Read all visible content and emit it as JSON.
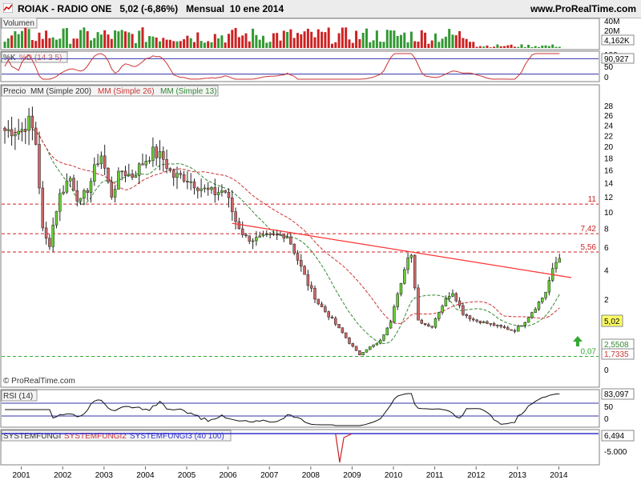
{
  "header": {
    "ticker": "ROIAK - RADIO ONE",
    "price_change": "5,02 (-6,86%)",
    "period": "Mensual",
    "date": "10 ene 2014",
    "site": "www.ProRealTime.com"
  },
  "volume_panel": {
    "label": "Volumen",
    "tick_top": "40M",
    "tick_mid": "20M",
    "last_value": "4,162K"
  },
  "stoch_panel": {
    "label_k": "%K",
    "label_d": "%D (14 3 5)",
    "tick_top": "100",
    "tick_mid": "50",
    "tick_bottom": "0",
    "last_value": "90,927"
  },
  "price_panel": {
    "label_price": "Precio",
    "label_mm200": "MM (Simple 200)",
    "label_mm26": "MM (Simple 26)",
    "label_mm13": "MM (Simple 13)",
    "copyright": "© ProRealTime.com",
    "hlines": [
      {
        "value": 11,
        "label": "11"
      },
      {
        "value": 7.42,
        "label": "7,42"
      },
      {
        "value": 5.56,
        "label": "5,56"
      },
      {
        "value": 0.07,
        "label": "0,07"
      }
    ],
    "value_tags": [
      {
        "label": "5,02",
        "color": "#ffff66"
      },
      {
        "label": "2,5508",
        "color": "#ffffff"
      },
      {
        "label": "1,7335",
        "color": "#ffffff"
      }
    ],
    "arrow_icon": "up-arrow-green"
  },
  "rsi_panel": {
    "label": "RSI (14)",
    "tick_mid": "50",
    "tick_bottom": "0",
    "last_value": "83,097"
  },
  "system_panel": {
    "label_1": "SYSTEMFUNGI",
    "label_2": "SYSTEMFUNGI2",
    "label_3": "SYSTEMFUNGI3 (40 100)",
    "tick_bottom": "-5.000",
    "last_value": "6,494"
  },
  "colors": {
    "up_candle": "#66cc33",
    "down_candle": "#cc6666",
    "mm26": "#cc3333",
    "mm13": "#338833",
    "trendline": "#ff3333",
    "panel_border": "#808080"
  },
  "chart_data": {
    "type": "candlestick",
    "title": "ROIAK - RADIO ONE",
    "x_axis_labels": [
      "2001",
      "2002",
      "2003",
      "2004",
      "2005",
      "2006",
      "2007",
      "2008",
      "2009",
      "2010",
      "2011",
      "2012",
      "2013",
      "2014"
    ],
    "y_axis_ticks": [
      "28",
      "26",
      "24",
      "22",
      "20",
      "18",
      "16",
      "14",
      "12",
      "10",
      "8",
      "6",
      "4",
      "2",
      "0"
    ],
    "y_scale": "sqrt",
    "ylim": [
      0,
      28
    ],
    "price_path": [
      [
        "2001-01",
        23
      ],
      [
        "2001-03",
        25
      ],
      [
        "2001-05",
        22
      ],
      [
        "2001-07",
        8
      ],
      [
        "2001-09",
        6
      ],
      [
        "2001-12",
        12
      ],
      [
        "2002-03",
        15
      ],
      [
        "2002-06",
        11
      ],
      [
        "2002-09",
        14
      ],
      [
        "2002-12",
        19
      ],
      [
        "2003-03",
        12
      ],
      [
        "2003-06",
        16
      ],
      [
        "2003-09",
        15
      ],
      [
        "2003-12",
        17
      ],
      [
        "2004-03",
        19
      ],
      [
        "2004-06",
        18
      ],
      [
        "2004-09",
        15
      ],
      [
        "2004-12",
        15
      ],
      [
        "2005-03",
        14
      ],
      [
        "2005-06",
        13
      ],
      [
        "2005-09",
        12.5
      ],
      [
        "2005-12",
        13
      ],
      [
        "2006-03",
        9
      ],
      [
        "2006-06",
        7
      ],
      [
        "2006-09",
        6.8
      ],
      [
        "2006-12",
        7
      ],
      [
        "2007-03",
        7.2
      ],
      [
        "2007-06",
        7.4
      ],
      [
        "2007-09",
        5
      ],
      [
        "2007-12",
        3
      ],
      [
        "2008-03",
        1.8
      ],
      [
        "2008-06",
        1.2
      ],
      [
        "2008-09",
        0.7
      ],
      [
        "2008-12",
        0.3
      ],
      [
        "2009-03",
        0.08
      ],
      [
        "2009-06",
        0.2
      ],
      [
        "2009-09",
        0.3
      ],
      [
        "2009-12",
        0.8
      ],
      [
        "2010-03",
        3
      ],
      [
        "2010-06",
        5.5
      ],
      [
        "2010-08",
        1
      ],
      [
        "2010-12",
        0.7
      ],
      [
        "2011-03",
        1.6
      ],
      [
        "2011-06",
        2.5
      ],
      [
        "2011-09",
        1.3
      ],
      [
        "2011-12",
        1
      ],
      [
        "2012-03",
        0.9
      ],
      [
        "2012-06",
        0.8
      ],
      [
        "2012-09",
        0.7
      ],
      [
        "2012-12",
        0.6
      ],
      [
        "2013-03",
        0.9
      ],
      [
        "2013-06",
        1.5
      ],
      [
        "2013-09",
        2.3
      ],
      [
        "2013-12",
        4.5
      ],
      [
        "2014-01",
        5.02
      ]
    ],
    "series": [
      {
        "name": "Precio",
        "last": 5.02
      },
      {
        "name": "MM (Simple 26)",
        "last": 1.7335
      },
      {
        "name": "MM (Simple 13)",
        "last": 2.5508
      }
    ],
    "horizontal_levels": [
      11,
      7.42,
      5.56,
      0.07
    ],
    "volume_last": "4,162K",
    "stoch_last": 90.927,
    "rsi_last": 83.097,
    "systemfungi_last": 6.494
  }
}
